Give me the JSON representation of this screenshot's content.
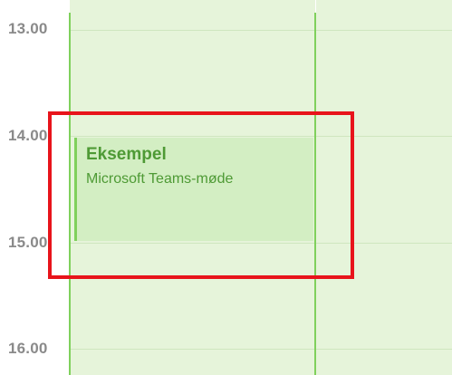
{
  "time_labels": [
    "13.00",
    "14.00",
    "15.00",
    "16.00"
  ],
  "event": {
    "title": "Eksempel",
    "subtitle": "Microsoft Teams-møde"
  },
  "colors": {
    "day_background": "#e6f4da",
    "event_background": "#d3eec3",
    "accent_green": "#7fd05c",
    "event_text": "#4e9a35",
    "time_text": "#8a8a8a",
    "highlight": "#e8141b"
  },
  "icons": []
}
